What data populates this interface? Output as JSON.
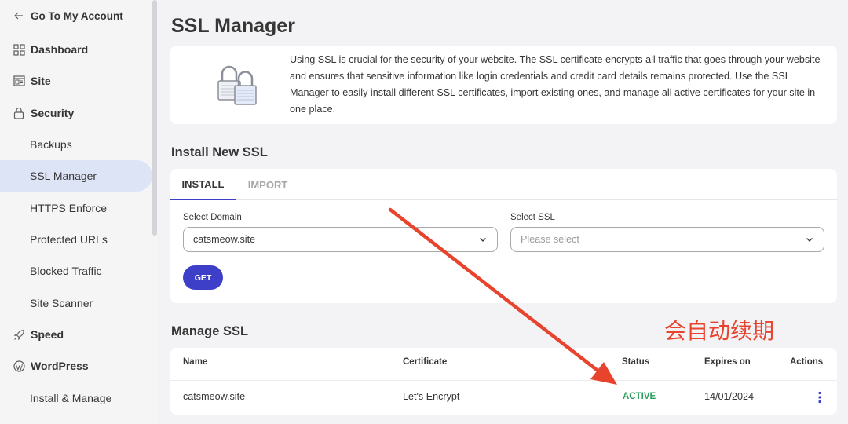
{
  "sidebar": {
    "back_label": "Go To My Account",
    "items": [
      {
        "label": "Dashboard"
      },
      {
        "label": "Site"
      },
      {
        "label": "Security"
      },
      {
        "label": "Backups"
      },
      {
        "label": "SSL Manager"
      },
      {
        "label": "HTTPS Enforce"
      },
      {
        "label": "Protected URLs"
      },
      {
        "label": "Blocked Traffic"
      },
      {
        "label": "Site Scanner"
      },
      {
        "label": "Speed"
      },
      {
        "label": "WordPress"
      },
      {
        "label": "Install & Manage"
      }
    ]
  },
  "page": {
    "title": "SSL Manager",
    "info_text": "Using SSL is crucial for the security of your website. The SSL certificate encrypts all traffic that goes through your website and ensures that sensitive information like login credentials and credit card details remains protected. Use the SSL Manager to easily install different SSL certificates, import existing ones, and manage all active certificates for your site in one place."
  },
  "install": {
    "title": "Install New SSL",
    "tabs": [
      {
        "label": "INSTALL"
      },
      {
        "label": "IMPORT"
      }
    ],
    "domain_label": "Select Domain",
    "domain_value": "catsmeow.site",
    "ssl_label": "Select SSL",
    "ssl_placeholder": "Please select",
    "get_label": "GET"
  },
  "annotation": "会自动续期",
  "manage": {
    "title": "Manage SSL",
    "columns": [
      "Name",
      "Certificate",
      "Status",
      "Expires on",
      "Actions"
    ],
    "rows": [
      {
        "name": "catsmeow.site",
        "certificate": "Let's Encrypt",
        "status": "ACTIVE",
        "expires": "14/01/2024"
      }
    ]
  },
  "colors": {
    "accent": "#3d3fc9",
    "status_active": "#2e9e5e",
    "annotation": "#e8432d",
    "active_nav_bg": "#dde4f5"
  }
}
